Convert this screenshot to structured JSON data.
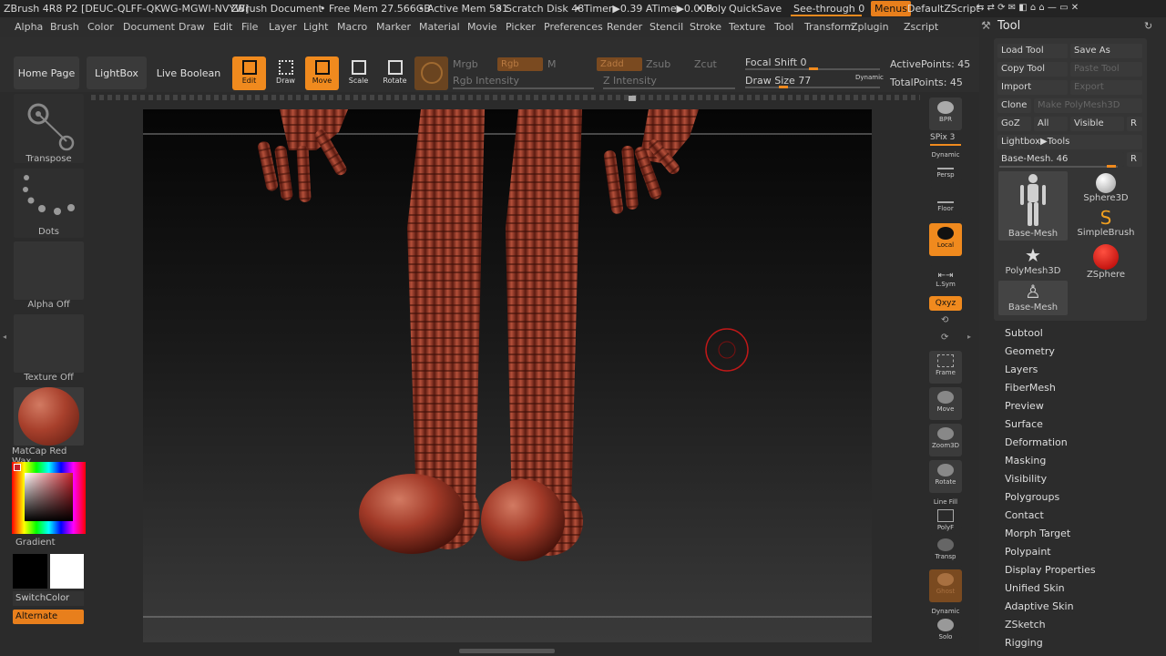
{
  "title_bar": {
    "app": "ZBrush 4R8 P2 [DEUC-QLFF-QKWG-MGWI-NVYW]",
    "document": "ZBrush Document",
    "free_mem": "• Free Mem 27.566GB",
    "active_mem": "• Active Mem 581",
    "scratch": "• Scratch Disk 48",
    "timer": "• Timer▶0.39 ATime▶0.006",
    "poly": "• Poly",
    "quicksave": "QuickSave",
    "see_through": "See-through",
    "see_through_value": "0",
    "menus": "Menus",
    "script": "DefaultZScript"
  },
  "menu_bar": [
    "Alpha",
    "Brush",
    "Color",
    "Document",
    "Draw",
    "Edit",
    "File",
    "Layer",
    "Light",
    "Macro",
    "Marker",
    "Material",
    "Movie",
    "Picker",
    "Preferences",
    "Render",
    "Stencil",
    "Stroke",
    "Texture",
    "Tool",
    "Transform",
    "Zplugin",
    "Zscript"
  ],
  "shelf": {
    "home_page": "Home Page",
    "lightbox": "LightBox",
    "live_boolean": "Live Boolean",
    "edit": "Edit",
    "draw": "Draw",
    "move": "Move",
    "scale": "Scale",
    "rotate": "Rotate",
    "mrgb": "Mrgb",
    "rgb": "Rgb",
    "m": "M",
    "zadd": "Zadd",
    "zsub": "Zsub",
    "zcut": "Zcut",
    "rgb_intensity": "Rgb Intensity",
    "z_intensity": "Z Intensity",
    "focal_shift_label": "Focal Shift",
    "focal_shift_value": "0",
    "draw_size_label": "Draw Size",
    "draw_size_value": "77",
    "dynamic": "Dynamic",
    "active_points": "ActivePoints: 45",
    "total_points": "TotalPoints: 45"
  },
  "left_panel": {
    "transpose": "Transpose",
    "dots": "Dots",
    "alpha": "Alpha Off",
    "texture": "Texture Off",
    "material": "MatCap Red Wax",
    "gradient": "Gradient",
    "switch_color": "SwitchColor",
    "alternate": "Alternate"
  },
  "right_shelf": {
    "bpr": "BPR",
    "spix": "SPix 3",
    "dynamic": "Dynamic",
    "persp": "Persp",
    "floor": "Floor",
    "local": "Local",
    "lsym": "L.Sym",
    "xyz": "Qxyz",
    "frame": "Frame",
    "move": "Move",
    "zoom3d": "Zoom3D",
    "rotate": "Rotate",
    "line_fill": "Line Fill",
    "polyf": "PolyF",
    "transp": "Transp",
    "ghost": "Ghost",
    "dynamic2": "Dynamic",
    "solo": "Solo"
  },
  "tool_panel": {
    "title": "Tool",
    "load_tool": "Load Tool",
    "save_as": "Save As",
    "copy_tool": "Copy Tool",
    "paste_tool": "Paste Tool",
    "import": "Import",
    "export": "Export",
    "clone": "Clone",
    "make_polymesh": "Make PolyMesh3D",
    "goz": "GoZ",
    "all": "All",
    "visible": "Visible",
    "r": "R",
    "lightbox_tools": "Lightbox▶Tools",
    "base_mesh_slider": "Base-Mesh. 46",
    "thumbs": [
      "Base-Mesh",
      "Sphere3D",
      "SimpleBrush",
      "PolyMesh3D",
      "ZSphere",
      "Base-Mesh"
    ],
    "subpalettes": [
      "Subtool",
      "Geometry",
      "Layers",
      "FiberMesh",
      "Preview",
      "Surface",
      "Deformation",
      "Masking",
      "Visibility",
      "Polygroups",
      "Contact",
      "Morph Target",
      "Polypaint",
      "Display Properties",
      "Unified Skin",
      "Adaptive Skin",
      "ZSketch",
      "Rigging"
    ]
  },
  "colors": {
    "accent": "#f08a1e",
    "wax_red": "#a8402c",
    "panel": "#2b2b2b"
  }
}
